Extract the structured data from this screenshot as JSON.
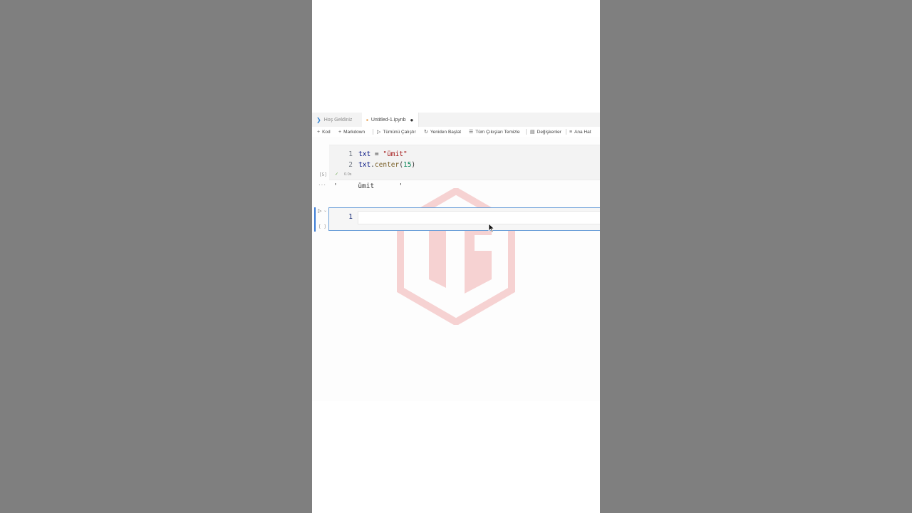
{
  "tabs": [
    {
      "label": "Hoş Geldiniz",
      "icon": "vscode-icon",
      "active": false
    },
    {
      "label": "Untitled-1.ipynb",
      "icon": "notebook-icon",
      "active": true,
      "dirty": true
    }
  ],
  "toolbar": {
    "code_label": "Kod",
    "markdown_label": "Markdown",
    "run_all_label": "Tümünü Çalıştır",
    "restart_label": "Yeniden Başlat",
    "clear_outputs_label": "Tüm Çıkışları Temizle",
    "variables_label": "Değişkenler",
    "outline_label": "Ana Hat"
  },
  "cells": [
    {
      "exec_count": "[5]",
      "status_time": "0.0s",
      "lines": [
        {
          "no": "1",
          "var": "txt",
          "op": " = ",
          "str": "\"ümit\""
        },
        {
          "no": "2",
          "var": "txt",
          "dot": ".",
          "fn": "center",
          "open": "(",
          "num": "15",
          "close": ")"
        }
      ],
      "output_more": "···",
      "output": "'     ümit      '"
    },
    {
      "exec_count": "[ ]",
      "lines": [
        {
          "no": "1"
        }
      ]
    }
  ],
  "colors": {
    "background": "#7f7f7f",
    "accent": "#3a7bd5",
    "string": "#a31515",
    "number": "#098658",
    "function": "#795e26",
    "variable": "#001080"
  }
}
